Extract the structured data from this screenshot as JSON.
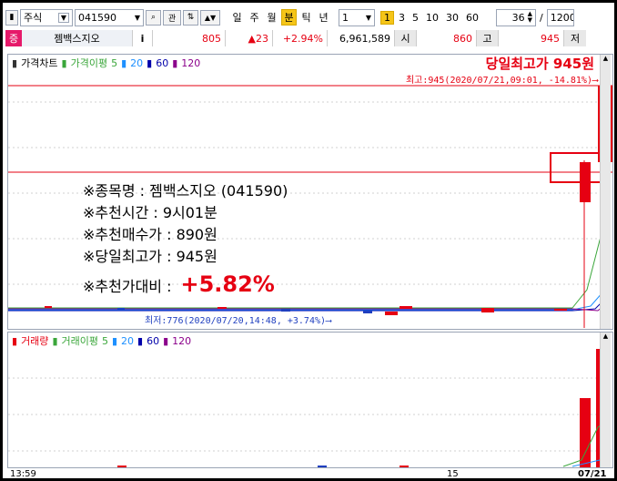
{
  "toolbar": {
    "market": "주식",
    "code": "041590",
    "search_icon": "search-icon",
    "btn_gwan": "관",
    "btn_up_down": "↑↓",
    "periods": [
      "일",
      "주",
      "월",
      "분",
      "틱",
      "년"
    ],
    "active_period": "분",
    "interval_value": "1",
    "num_buttons": [
      "1",
      "3",
      "5",
      "10",
      "30",
      "60"
    ],
    "active_num": "1",
    "count_value": "36",
    "slash": "/",
    "total_value": "1200"
  },
  "quote": {
    "market_tag": "증",
    "name": "젬백스지오",
    "info_btn": "i",
    "price": "805",
    "change": "▲23",
    "change_pct": "+2.94%",
    "volume": "6,961,589",
    "open_label": "시",
    "open": "860",
    "high_label": "고",
    "high": "945",
    "low_label": "저"
  },
  "price_panel": {
    "legend_title": "가격차트",
    "ma_label": "가격이평",
    "ma_values": [
      "5",
      "20",
      "60",
      "120"
    ],
    "day_high_title": "당일최고가 945원",
    "high_annotation": "최고:945(2020/07/21,09:01, -14.81%)⟶",
    "low_annotation": "최저:776(2020/07/20,14:48, +3.74%)⟶"
  },
  "overlay": {
    "line1": "※종목명 : 젬백스지오 (041590)",
    "line2": "※추천시간 : 9시01분",
    "line3": "※추천매수가 : 890원",
    "line4": "※당일최고가 : 945원",
    "line5_label": "※추천가대비 :",
    "line5_value": "+5.82%"
  },
  "volume_panel": {
    "legend_title": "거래량",
    "ma_label": "거래이평",
    "ma_values": [
      "5",
      "20",
      "60",
      "120"
    ]
  },
  "x_axis": {
    "labels": [
      "13:59",
      "15",
      "07/21"
    ]
  },
  "colors": {
    "up": "#e60012",
    "down": "#1f3fbf",
    "ma5": "#3aa63a",
    "ma20": "#1e90ff",
    "ma60": "#0000aa",
    "ma120": "#8b008b"
  }
}
